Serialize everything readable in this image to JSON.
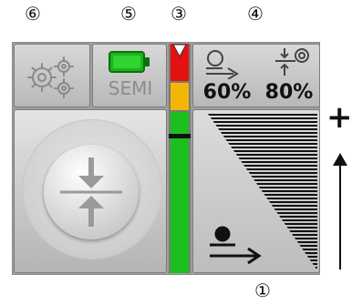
{
  "callouts": {
    "c6": "⑥",
    "c5": "⑤",
    "c3": "③",
    "c4": "④",
    "c1": "①"
  },
  "toolbar": {
    "settings_icon": "gear-icon",
    "mode_label": "SEMI",
    "battery_icon": "battery-icon",
    "battery_color": "#1db31d",
    "feed_value": "60%",
    "force_value": "80%"
  },
  "level_bar": {
    "colors": {
      "red": "#e41111",
      "yellow": "#f2b705",
      "green": "#1dbf1d"
    }
  },
  "side": {
    "plus_label": "+"
  }
}
